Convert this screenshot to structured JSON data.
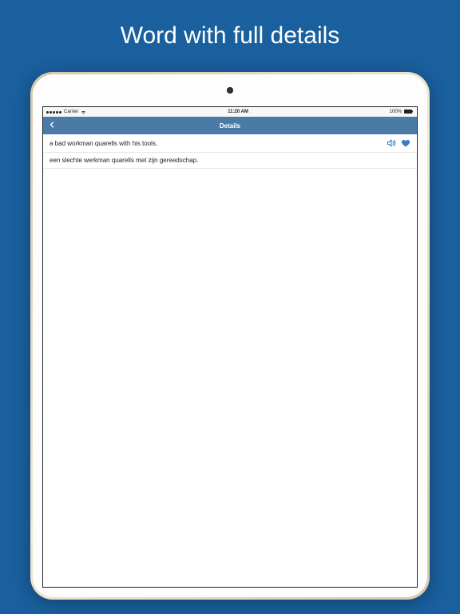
{
  "promo": {
    "headline": "Word with full details"
  },
  "status": {
    "carrier": "Carrier",
    "time": "11:20 AM",
    "battery": "100%"
  },
  "nav": {
    "title": "Details"
  },
  "entry": {
    "source": "a bad workman quarells with his tools.",
    "translation": "een slechte werkman quarells met zijn gereedschap."
  },
  "colors": {
    "bg": "#1a5f9e",
    "navbar": "#4a7ba6",
    "accent": "#3a7bc8"
  }
}
